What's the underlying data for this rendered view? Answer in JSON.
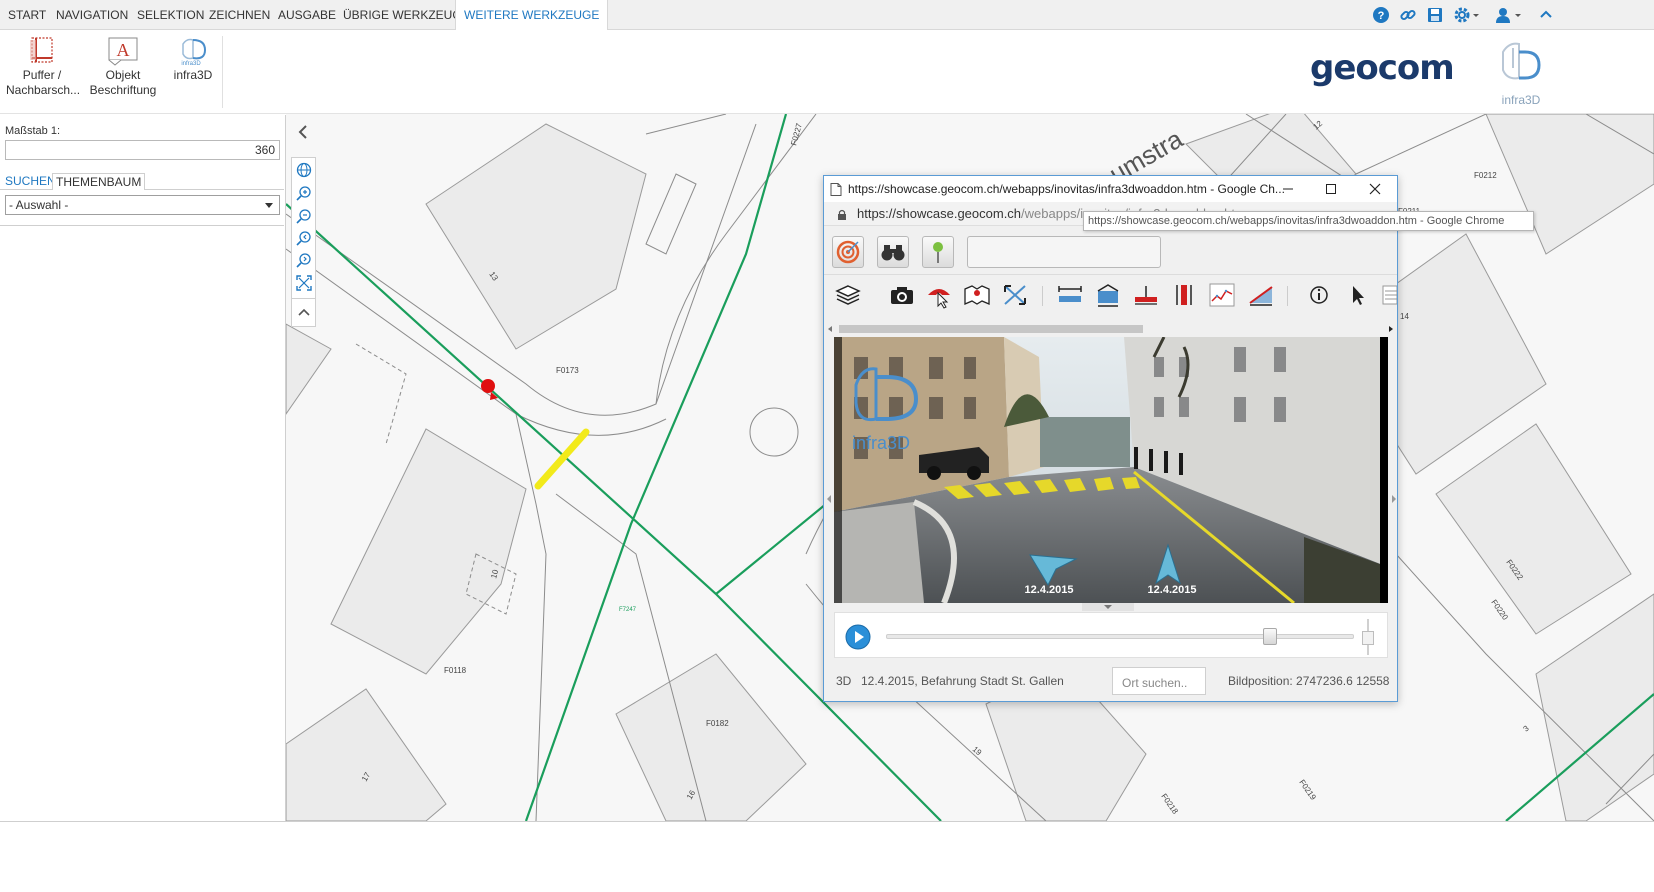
{
  "menu": {
    "tabs": [
      "START",
      "NAVIGATION",
      "SELEKTION",
      "ZEICHNEN",
      "AUSGABE",
      "ÜBRIGE WERKZEUGE",
      "WEITERE WERKZEUGE"
    ],
    "active_tab": "WEITERE WERKZEUGE",
    "right_icons": [
      "help-icon",
      "link-icon",
      "save-icon",
      "settings-icon",
      "user-icon",
      "collapse-up-icon"
    ]
  },
  "ribbon": {
    "buttons": [
      {
        "line1": "Puffer /",
        "line2": "Nachbarsch...",
        "icon": "buffer-icon"
      },
      {
        "line1": "Objekt",
        "line2": "Beschriftung",
        "icon": "label-icon"
      },
      {
        "line1": "infra3D",
        "line2": "",
        "icon": "infra3d-icon"
      }
    ],
    "brand_logo": "geocom",
    "infra_logo": "infra3D"
  },
  "left_panel": {
    "scale_label": "Maßstab 1:",
    "scale_value": "360",
    "tabs": [
      "SUCHEN",
      "THEMENBAUM"
    ],
    "select_value": "- Auswahl -"
  },
  "map": {
    "parcel_labels": [
      "F0173",
      "F0118",
      "F0182",
      "F0212",
      "F0211",
      "F0222",
      "F0220",
      "F0219",
      "F0218",
      "F0227",
      "F7247",
      "14"
    ],
    "house_numbers": [
      "13",
      "10",
      "17",
      "16",
      "12",
      "19",
      "3"
    ],
    "street_fragment": "umstra",
    "highlight_color": "#f2ea1a",
    "pipe_color": "#1a9e5c",
    "marker_color": "#e01010"
  },
  "popup": {
    "title": "https://showcase.geocom.ch/webapps/inovitas/infra3dwoaddon.htm - Google Ch...",
    "url_prefix": "https://showcase.geocom.ch",
    "url_path": "/webapps/inovitas/infra3dwoaddon.htm",
    "tooltip": "https://showcase.geocom.ch/webapps/inovitas/infra3dwoaddon.htm - Google Chrome",
    "viewer": {
      "logo_text": "infra3D",
      "arrow_date_left": "12.4.2015",
      "arrow_date_right": "12.4.2015"
    },
    "slider_position": 0.82,
    "status": {
      "mode": "3D",
      "campaign": "12.4.2015, Befahrung Stadt St. Gallen",
      "search_placeholder": "Ort suchen..",
      "position": "Bildposition: 2747236.6 12558"
    }
  }
}
